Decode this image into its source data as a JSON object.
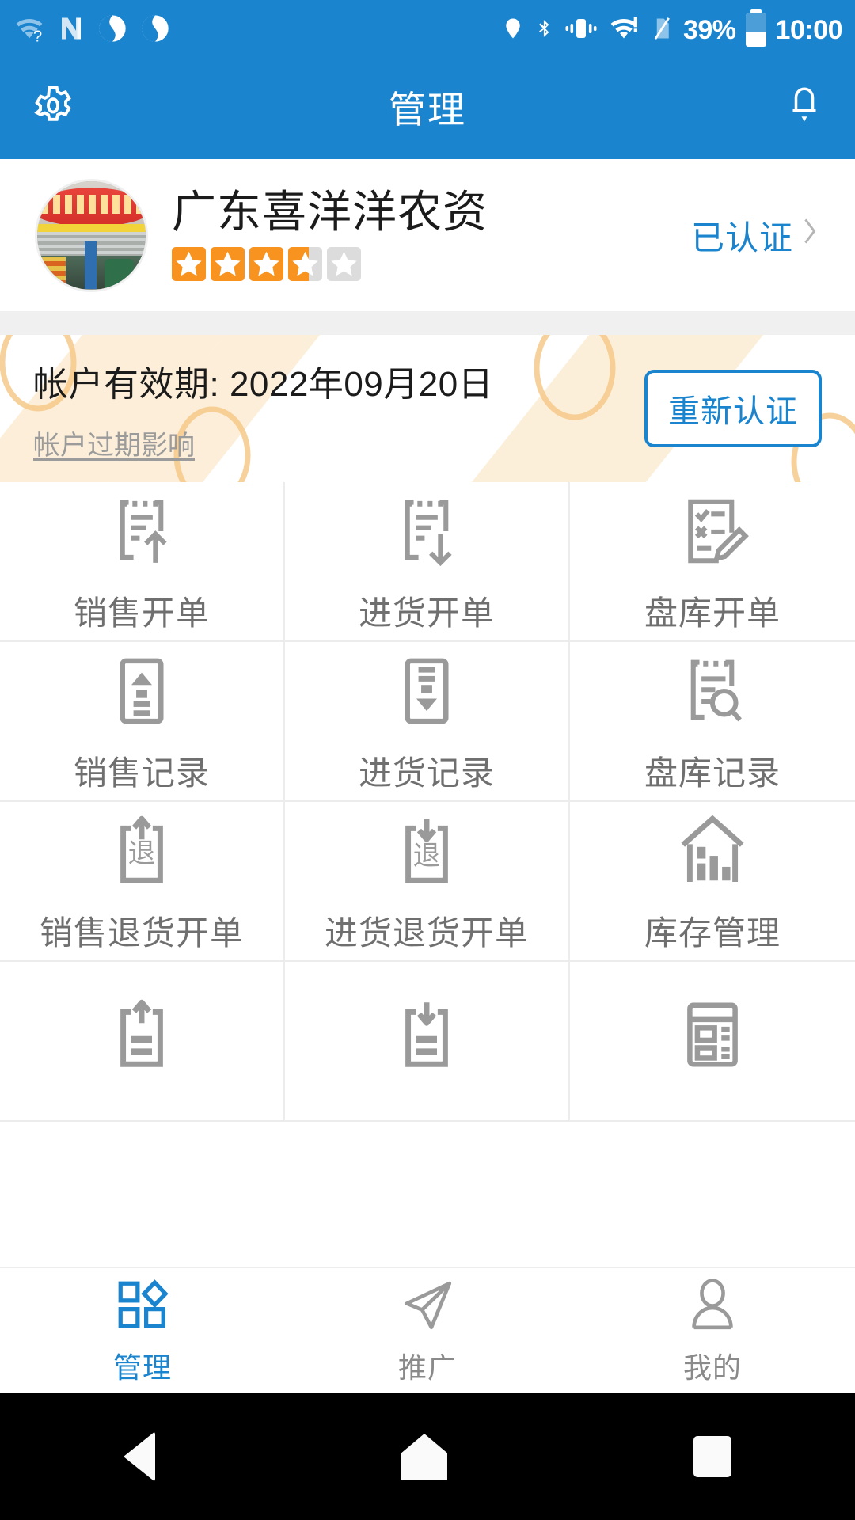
{
  "status_bar": {
    "battery_percent": "39%",
    "time": "10:00",
    "icons": [
      "wifi-question-icon",
      "n-logo-icon",
      "sync-icon",
      "sync-icon-2",
      "location-icon",
      "bluetooth-icon",
      "vibrate-icon",
      "wifi-alert-icon",
      "sim-slash-icon",
      "battery-icon"
    ]
  },
  "app_bar": {
    "title": "管理",
    "settings_icon": "gear-icon",
    "notification_icon": "bell-icon"
  },
  "profile": {
    "shop_name": "广东喜洋洋农资",
    "rating": 3.6,
    "max_rating": 5,
    "verified_label": "已认证",
    "avatar_alt": "喜洋洋农资 storefront photo"
  },
  "account": {
    "validity_label": "帐户有效期: 2022年09月20日",
    "expire_info_link": "帐户过期影响",
    "recertify_button": "重新认证"
  },
  "grid": {
    "items": [
      {
        "label": "销售开单",
        "icon": "doc-up-arrow-icon"
      },
      {
        "label": "进货开单",
        "icon": "doc-down-arrow-icon"
      },
      {
        "label": "盘库开单",
        "icon": "checklist-pencil-icon"
      },
      {
        "label": "销售记录",
        "icon": "box-up-icon"
      },
      {
        "label": "进货记录",
        "icon": "box-down-icon"
      },
      {
        "label": "盘库记录",
        "icon": "doc-search-icon"
      },
      {
        "label": "销售退货开单",
        "icon": "return-up-icon"
      },
      {
        "label": "进货退货开单",
        "icon": "return-down-icon"
      },
      {
        "label": "库存管理",
        "icon": "warehouse-icon"
      },
      {
        "label": "",
        "icon": "doc-up-line-icon"
      },
      {
        "label": "",
        "icon": "doc-down-line-icon"
      },
      {
        "label": "",
        "icon": "report-icon"
      }
    ]
  },
  "tab_bar": {
    "tabs": [
      {
        "label": "管理",
        "icon": "grid-diamond-icon",
        "active": true
      },
      {
        "label": "推广",
        "icon": "paper-plane-icon",
        "active": false
      },
      {
        "label": "我的",
        "icon": "person-icon",
        "active": false
      }
    ]
  },
  "system_nav": {
    "back": "back-triangle-icon",
    "home": "home-pentagon-icon",
    "recents": "recents-square-icon"
  },
  "colors": {
    "brand_blue": "#1a84ce",
    "star_orange": "#f7931e",
    "star_empty": "#dcdcdc",
    "icon_gray": "#9a9a9a",
    "label_gray": "#6f6f6f"
  }
}
